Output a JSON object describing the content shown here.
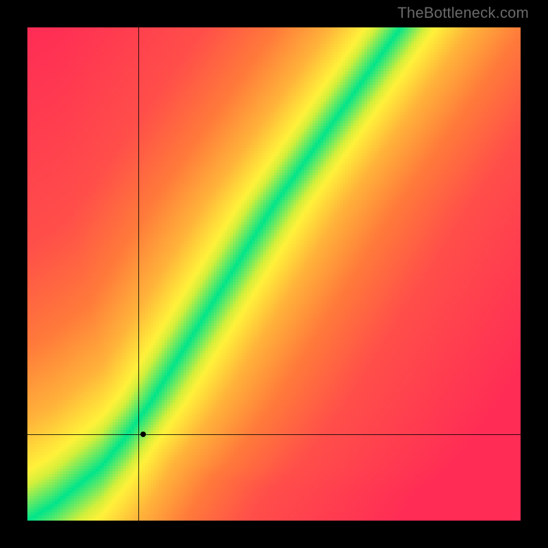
{
  "watermark": "TheBottleneck.com",
  "chart_data": {
    "type": "heatmap",
    "title": "",
    "xlabel": "",
    "ylabel": "",
    "xlim": [
      0,
      100
    ],
    "ylim": [
      0,
      100
    ],
    "grid": false,
    "legend": false,
    "colorscale": {
      "description": "distance from optimal curve",
      "stops": [
        {
          "d": 0.0,
          "color": "#00e58b"
        },
        {
          "d": 0.07,
          "color": "#d4ef3a"
        },
        {
          "d": 0.1,
          "color": "#fff13a"
        },
        {
          "d": 0.2,
          "color": "#ffb33a"
        },
        {
          "d": 0.35,
          "color": "#ff7a3a"
        },
        {
          "d": 0.55,
          "color": "#ff4f49"
        },
        {
          "d": 1.0,
          "color": "#ff2c55"
        }
      ]
    },
    "optimal_curve": {
      "description": "green ridge y as function of x (normalized 0..1, origin bottom-left)",
      "points": [
        {
          "x": 0.0,
          "y": 0.0
        },
        {
          "x": 0.05,
          "y": 0.03
        },
        {
          "x": 0.1,
          "y": 0.07
        },
        {
          "x": 0.15,
          "y": 0.11
        },
        {
          "x": 0.2,
          "y": 0.17
        },
        {
          "x": 0.25,
          "y": 0.24
        },
        {
          "x": 0.3,
          "y": 0.32
        },
        {
          "x": 0.35,
          "y": 0.4
        },
        {
          "x": 0.4,
          "y": 0.48
        },
        {
          "x": 0.45,
          "y": 0.56
        },
        {
          "x": 0.5,
          "y": 0.64
        },
        {
          "x": 0.55,
          "y": 0.71
        },
        {
          "x": 0.6,
          "y": 0.78
        },
        {
          "x": 0.65,
          "y": 0.85
        },
        {
          "x": 0.7,
          "y": 0.92
        },
        {
          "x": 0.75,
          "y": 0.99
        },
        {
          "x": 0.8,
          "y": 1.06
        }
      ]
    },
    "crosshair": {
      "x": 0.225,
      "y": 0.175
    },
    "marker": {
      "x": 0.235,
      "y": 0.175
    }
  }
}
